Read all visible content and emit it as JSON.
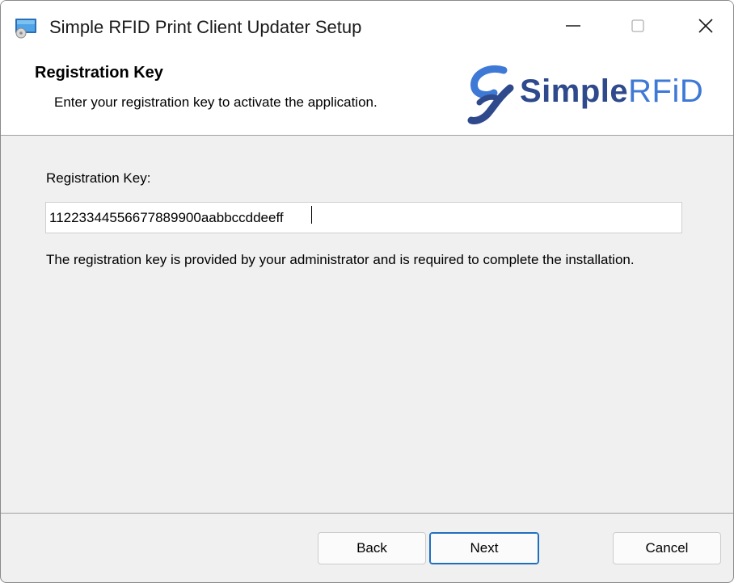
{
  "window": {
    "title": "Simple RFID Print Client Updater Setup",
    "icon": "installer-icon",
    "controls": {
      "minimize": "minimize-icon",
      "maximize": "maximize-icon",
      "close": "close-icon"
    }
  },
  "banner": {
    "title": "Registration Key",
    "subtitle": "Enter your registration key to activate the application.",
    "logo": {
      "text_bold": "Simple",
      "text_light": "RFiD",
      "colors": {
        "dark": "#2f4a8c",
        "light": "#3f79d6"
      }
    }
  },
  "form": {
    "label": "Registration Key:",
    "value": "11223344556677889900aabbccddeeff",
    "help": "The registration key is provided by your administrator and is required to complete the installation."
  },
  "buttons": {
    "back": "Back",
    "next": "Next",
    "cancel": "Cancel"
  }
}
